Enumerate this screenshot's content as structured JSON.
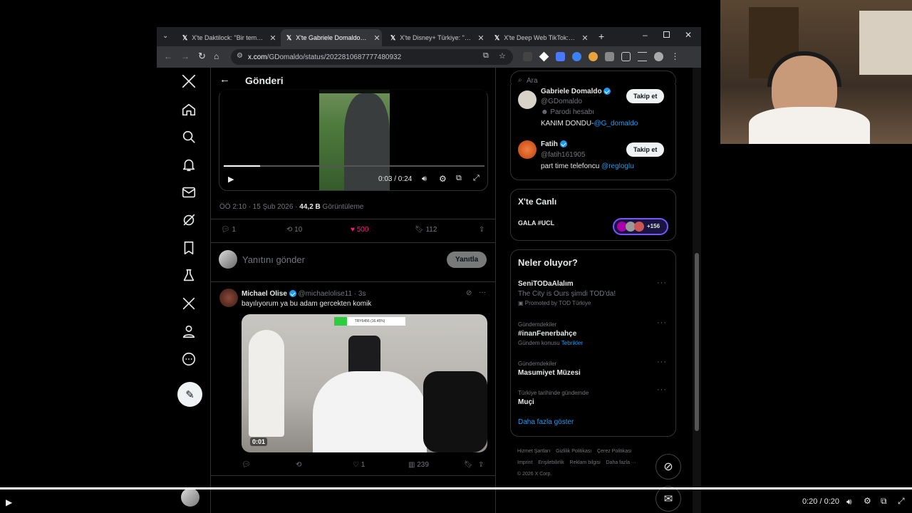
{
  "browser": {
    "tabs": [
      {
        "title": "X'te Daktilock: \"Bir temizlik ç"
      },
      {
        "title": "X'te Gabriele Domaldo: \"Biz"
      },
      {
        "title": "X'te Disney+ Türkiye: \"Aynı ç"
      },
      {
        "title": "X'te Deep Web TikTok: \"bu a"
      }
    ],
    "url_domain": "x.com",
    "url_path": "/GDomaldo/status/2022810687777480932"
  },
  "header": {
    "title": "Gönderi"
  },
  "video": {
    "time": "0:03 / 0:24",
    "progress": 0.14
  },
  "post_meta": {
    "time": "ÖÖ 2:10 · 15 Şub 2026 ·",
    "views": "44,2 B",
    "views_label": "Görüntüleme"
  },
  "actions": {
    "replies": "1",
    "reposts": "10",
    "likes": "500",
    "bookmarks": "112"
  },
  "reply_box": {
    "placeholder": "Yanıtını gönder",
    "button": "Yanıtla"
  },
  "reply": {
    "name": "Michael Olise",
    "handle": "@michaelolise11 · 3s",
    "text": "bayılıyorum ya bu adam gercekten komik",
    "video_time": "0:01",
    "overlay_text": "TRY6456 (16.45%)",
    "stats": {
      "likes": "1",
      "views": "239"
    }
  },
  "search": {
    "placeholder": "Ara"
  },
  "follow_suggestions": [
    {
      "name": "Gabriele Domaldo",
      "handle": "@GDomaldo",
      "badge": "Parodi hesabı",
      "bio_text": "KANIM DONDU-",
      "bio_link": "@G_domaldo",
      "button": "Takip et"
    },
    {
      "name": "Fatih",
      "handle": "@fatih161905",
      "bio_text": "part time telefoncu ",
      "bio_link": "@regloglu",
      "button": "Takip et"
    }
  ],
  "live": {
    "title": "X'te Canlı",
    "item": "GALA #UCL",
    "count": "+156"
  },
  "trends": {
    "title": "Neler oluyor?",
    "items": [
      {
        "category": "",
        "name": "SeniTODaAlalım",
        "desc": "The City is Ours şimdi TOD'da!",
        "extra": "Promoted by TOD Türkiye",
        "link": ""
      },
      {
        "category": "Gündemdekiler",
        "name": "#inanFenerbahçe",
        "desc": "Gündem konusu ",
        "extra": "",
        "link": "Tebrikler"
      },
      {
        "category": "Gündemdekiler",
        "name": "Masumiyet Müzesi",
        "desc": "",
        "extra": "",
        "link": ""
      },
      {
        "category": "Türkiye tarihinde gündemde",
        "name": "Muçi",
        "desc": "",
        "extra": "",
        "link": ""
      }
    ],
    "show_more": "Daha fazla göster"
  },
  "footer": {
    "links": [
      "Hizmet Şartları",
      "Gizlilik Politikası",
      "Çerez Politikası",
      "Imprint",
      "Erişilebilirlik",
      "Reklam bilgisi",
      "Daha fazla ···"
    ],
    "copyright": "© 2026 X Corp."
  },
  "player": {
    "time": "0:20 / 0:20",
    "progress": 1.0
  }
}
